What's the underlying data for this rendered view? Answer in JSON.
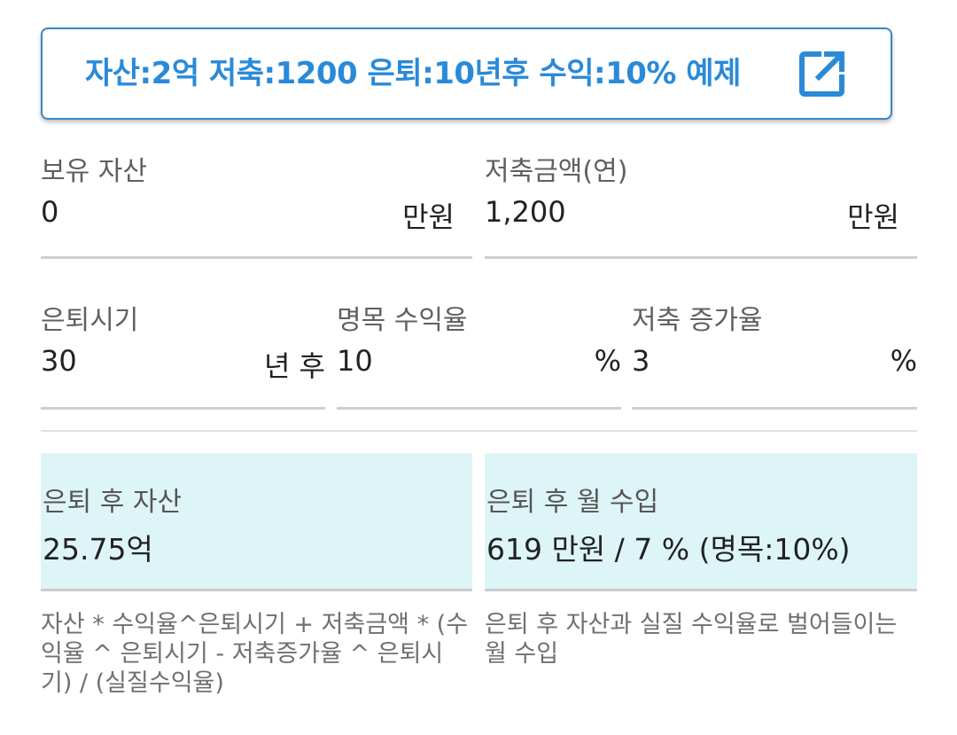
{
  "example_button": {
    "label": "자산:2억 저축:1200 은퇴:10년후 수익:10% 예제",
    "icon": "open-in-new-icon",
    "accent_color": "#2a8ad8"
  },
  "fields": {
    "assets": {
      "label": "보유 자산",
      "value": "0",
      "unit": "만원"
    },
    "savings": {
      "label": "저축금액(연)",
      "value": "1,200",
      "unit": "만원"
    },
    "retire": {
      "label": "은퇴시기",
      "value": "30",
      "unit": "년 후"
    },
    "nominal_return": {
      "label": "명목 수익율",
      "value": "10",
      "unit": "%"
    },
    "savings_growth": {
      "label": "저축 증가율",
      "value": "3",
      "unit": "%"
    }
  },
  "results": {
    "assets_after": {
      "label": "은퇴 후 자산",
      "value": "25.75억"
    },
    "monthly_income": {
      "label": "은퇴 후 월 수입",
      "value": "619 만원 / 7 % (명목:10%)"
    }
  },
  "notes": {
    "formula": "자산 * 수익율^은퇴시기 + 저축금액 * (수익율 ^ 은퇴시기 - 저축증가율 ^ 은퇴시기) / (실질수익율)",
    "income_desc": "은퇴 후 자산과 실질 수익율로 벌어들이는 월 수입"
  },
  "colors": {
    "result_bg": "#def5f8",
    "underline": "#cfcfcf"
  }
}
